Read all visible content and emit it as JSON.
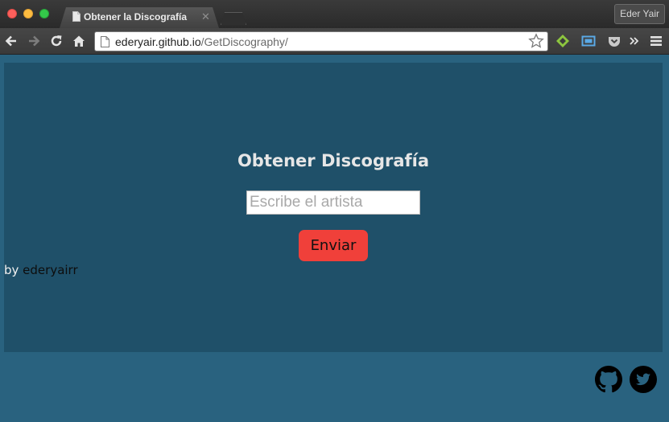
{
  "browser": {
    "tab_title": "Obtener la Discografía",
    "tab_close": "✕",
    "profile_name": "Eder Yair",
    "url_host": "ederyair.github.io",
    "url_path": "/GetDiscography/"
  },
  "main": {
    "heading": "Obtener Discografía",
    "search_placeholder": "Escribe el artista",
    "submit_label": "Enviar",
    "credit_prefix": "by ",
    "credit_author": "ederyairr"
  },
  "footer": {
    "icons": [
      "github-icon",
      "twitter-icon"
    ]
  },
  "colors": {
    "page_background": "#29627f",
    "card_background": "#1f5069",
    "button_background": "#f0403a",
    "heading_text": "#e6e6e6"
  }
}
